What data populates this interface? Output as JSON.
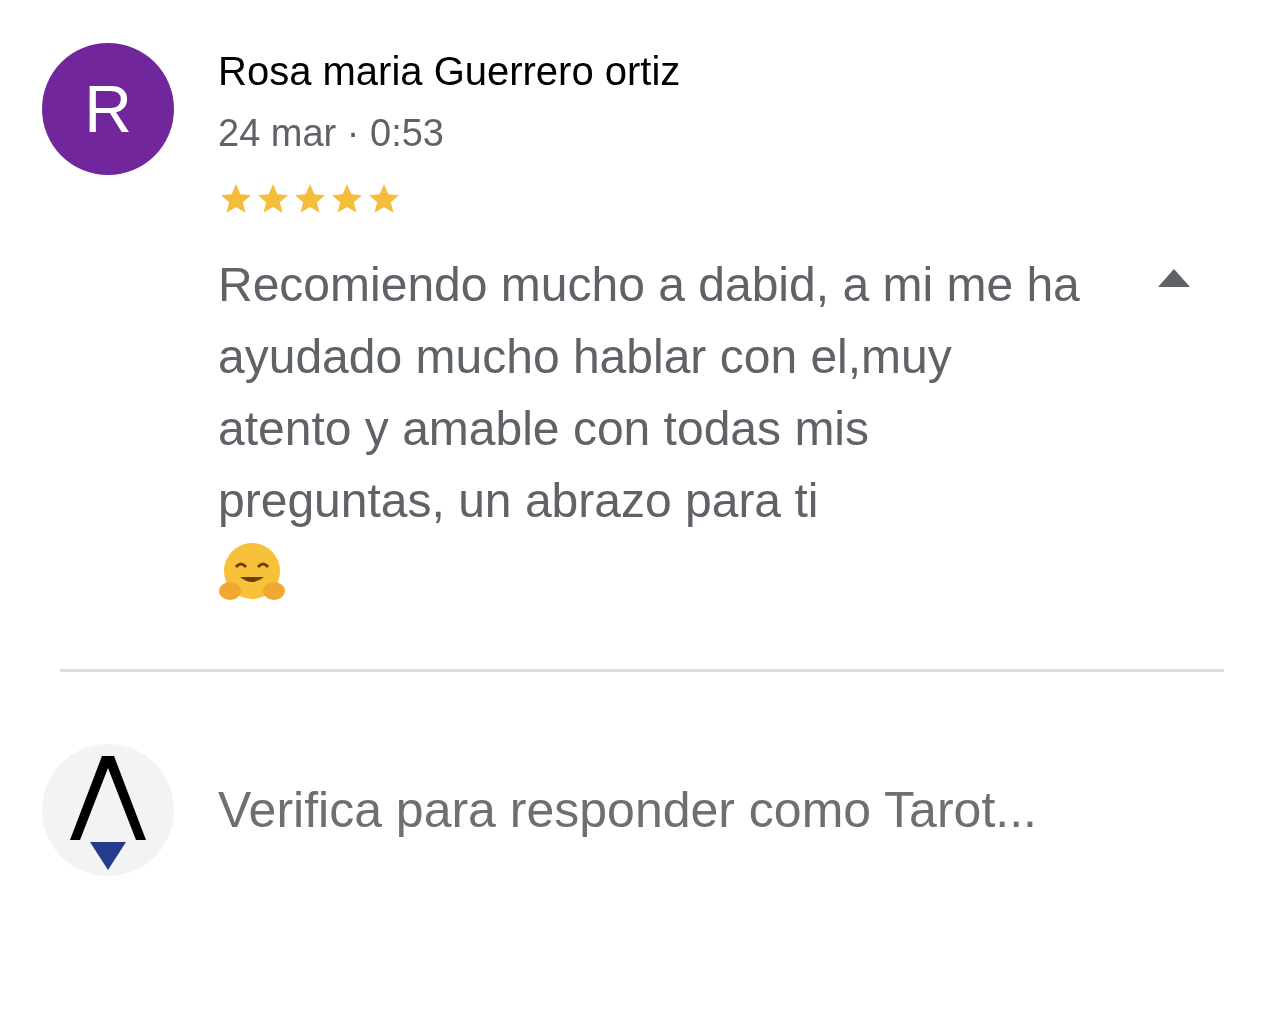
{
  "review": {
    "avatar_letter": "R",
    "author": "Rosa maria Guerrero ortiz",
    "date": "24 mar · 0:53",
    "stars": 5,
    "text": "Recomiendo mucho a dabid, a mi me ha ayudado mucho hablar con el,muy atento y amable con todas mis preguntas, un abrazo para ti",
    "expanded": true
  },
  "reply": {
    "prompt": "Verifica para responder como Tarot..."
  }
}
